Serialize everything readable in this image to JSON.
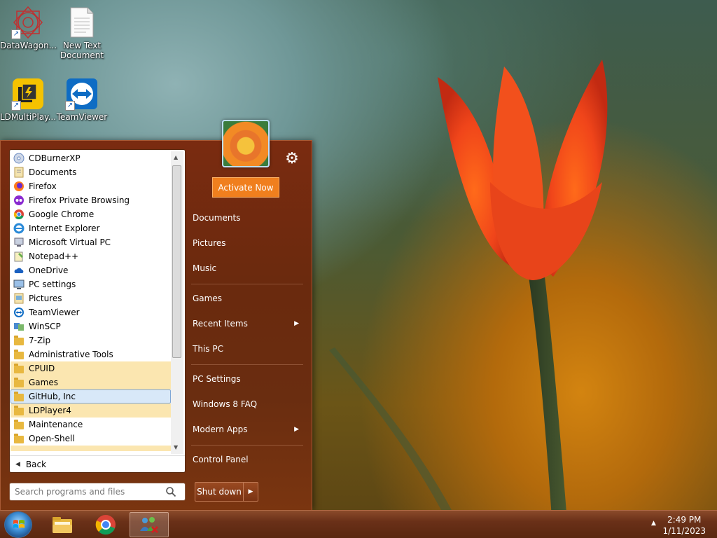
{
  "desktop": {
    "icons": [
      {
        "label": "DataWagon...",
        "icon": "datawagon-icon"
      },
      {
        "label": "New Text Document",
        "icon": "text-document-icon"
      },
      {
        "label": "LDMultiPlay...",
        "icon": "ldmultiplayer-icon"
      },
      {
        "label": "TeamViewer",
        "icon": "teamviewer-icon"
      }
    ]
  },
  "start_menu": {
    "programs": [
      {
        "label": "CDBurnerXP",
        "icon": "cdburner-icon"
      },
      {
        "label": "Documents",
        "icon": "documents-icon"
      },
      {
        "label": "Firefox",
        "icon": "firefox-icon"
      },
      {
        "label": "Firefox Private Browsing",
        "icon": "firefox-private-icon"
      },
      {
        "label": "Google Chrome",
        "icon": "chrome-icon"
      },
      {
        "label": "Internet Explorer",
        "icon": "ie-icon"
      },
      {
        "label": "Microsoft Virtual PC",
        "icon": "virtual-pc-icon"
      },
      {
        "label": "Notepad++",
        "icon": "notepadpp-icon"
      },
      {
        "label": "OneDrive",
        "icon": "onedrive-icon"
      },
      {
        "label": "PC settings",
        "icon": "pc-settings-icon"
      },
      {
        "label": "Pictures",
        "icon": "pictures-icon"
      },
      {
        "label": "TeamViewer",
        "icon": "teamviewer-icon"
      },
      {
        "label": "WinSCP",
        "icon": "winscp-icon"
      },
      {
        "label": "7-Zip",
        "icon": "folder-icon"
      },
      {
        "label": "Administrative Tools",
        "icon": "folder-icon"
      },
      {
        "label": "CPUID",
        "icon": "folder-icon"
      },
      {
        "label": "Games",
        "icon": "folder-icon"
      },
      {
        "label": "GitHub, Inc",
        "icon": "folder-icon"
      },
      {
        "label": "LDPlayer4",
        "icon": "folder-icon"
      },
      {
        "label": "Maintenance",
        "icon": "folder-icon"
      },
      {
        "label": "Open-Shell",
        "icon": "folder-icon"
      }
    ],
    "back_label": "Back",
    "search_placeholder": "Search programs and files",
    "activate_label": "Activate Now",
    "right_links": [
      {
        "label": "Documents"
      },
      {
        "label": "Pictures"
      },
      {
        "label": "Music"
      },
      {
        "label": "Games"
      },
      {
        "label": "Recent Items"
      },
      {
        "label": "This PC"
      },
      {
        "label": "PC Settings"
      },
      {
        "label": "Windows 8 FAQ"
      },
      {
        "label": "Modern Apps"
      },
      {
        "label": "Control Panel"
      }
    ],
    "shutdown_label": "Shut down"
  },
  "taskbar": {
    "apps": [
      {
        "name": "file-explorer-icon"
      },
      {
        "name": "chrome-icon"
      },
      {
        "name": "network-app-icon"
      }
    ],
    "time": "2:49 PM",
    "date": "1/11/2023"
  }
}
